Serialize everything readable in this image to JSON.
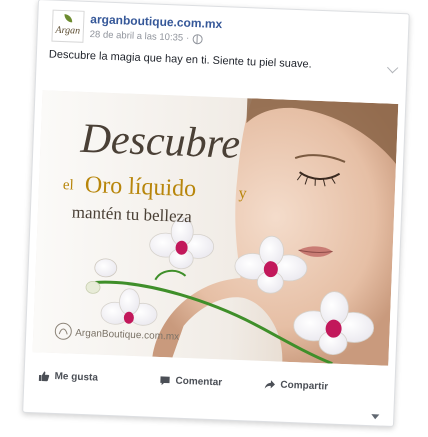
{
  "post": {
    "page_name": "arganboutique.com.mx",
    "timestamp": "28 de abril a las 10:35",
    "separator": "·",
    "text": "Descubre la magia que hay en ti. Siente tu piel suave.",
    "avatar_text": "Argan"
  },
  "image": {
    "headline": "Descubre",
    "line2_prefix": "el",
    "line2_emphasis": "Oro líquido",
    "line2_suffix": "y",
    "line3": "mantén tu belleza",
    "watermark": "ArganBoutique.com.mx"
  },
  "actions": {
    "like": "Me gusta",
    "comment": "Comentar",
    "share": "Compartir"
  },
  "colors": {
    "link": "#365899",
    "gold": "#b8860b",
    "dark_text": "#4a4036",
    "orchid": "#c2185b",
    "leaf_green": "#3f8f2a"
  },
  "icons": {
    "like": "thumbs-up-icon",
    "comment": "comment-bubble-icon",
    "share": "share-arrow-icon",
    "privacy": "globe-icon",
    "menu": "chevron-down-icon"
  }
}
